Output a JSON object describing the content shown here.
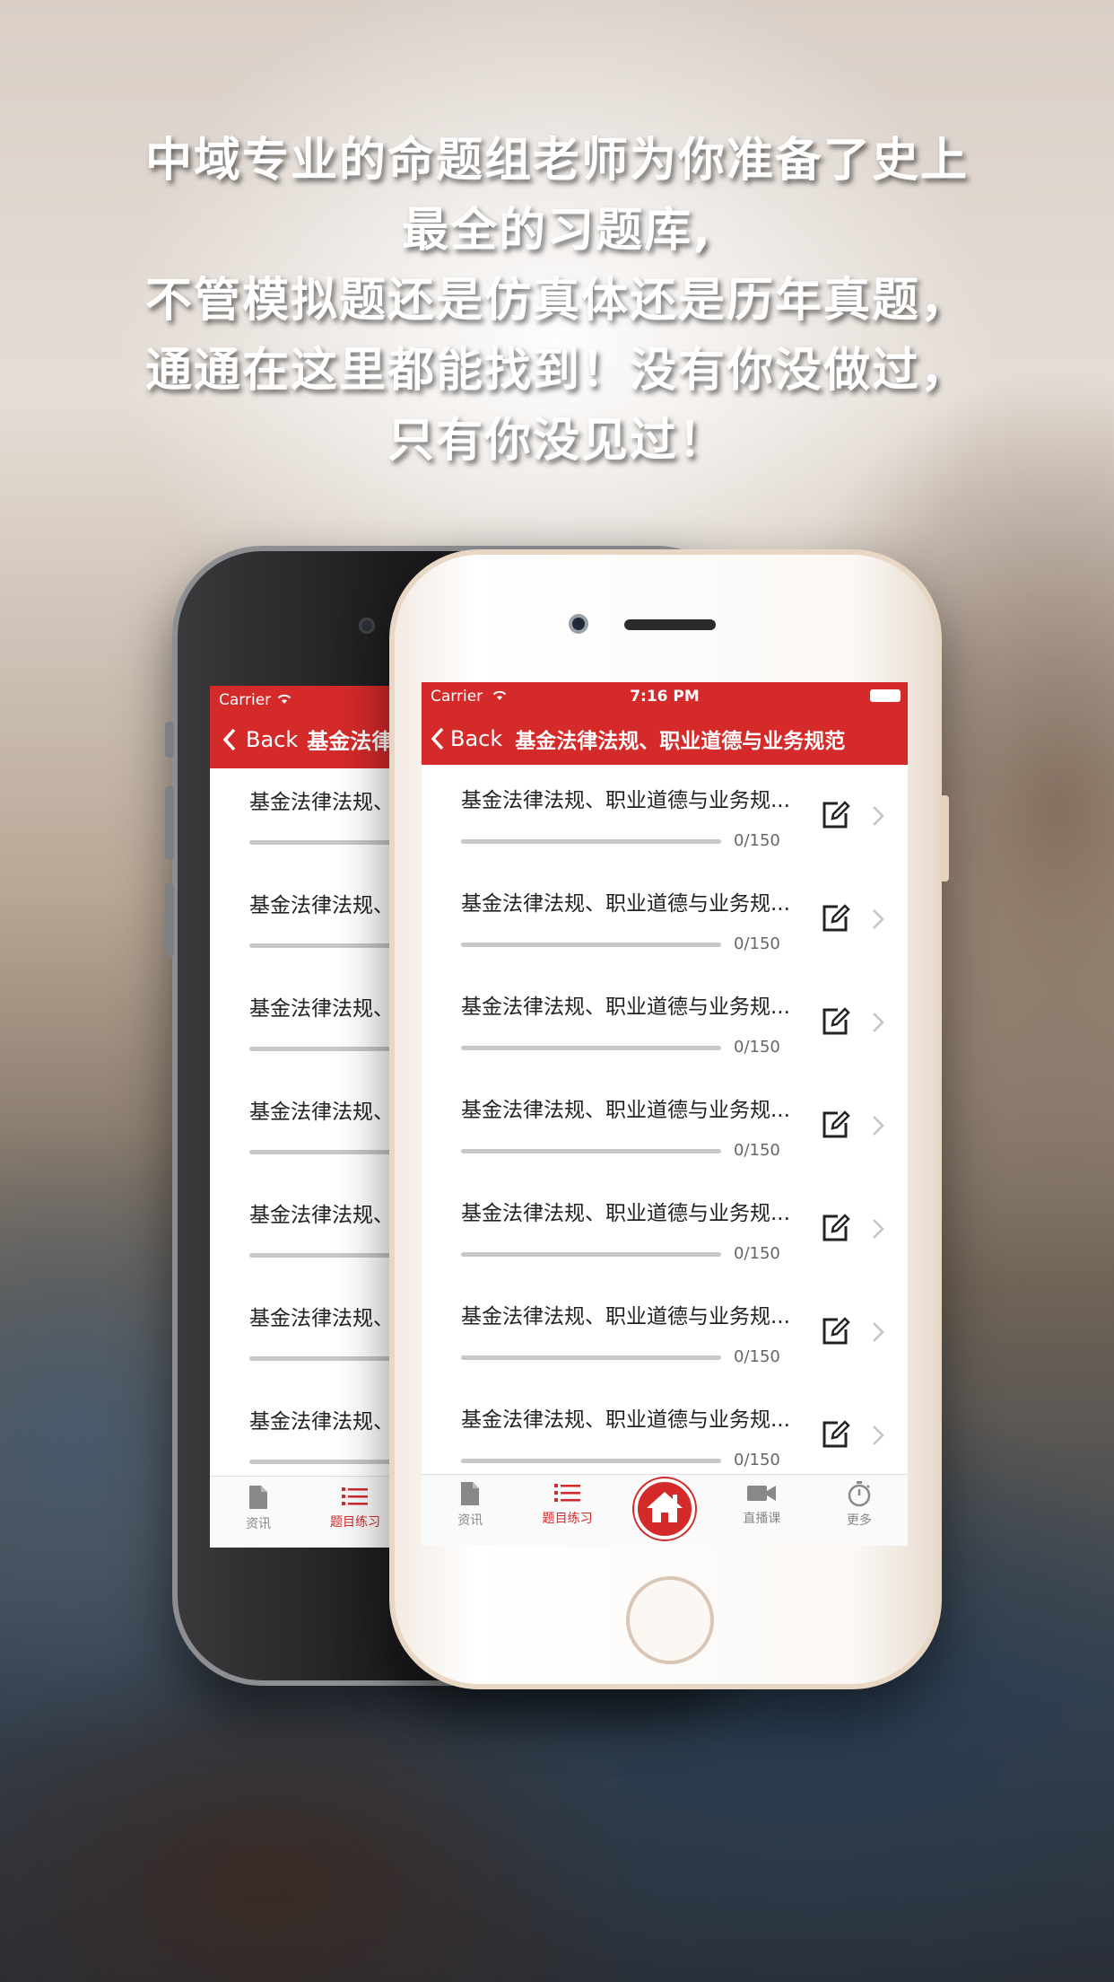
{
  "headline": {
    "line1": "中域专业的命题组老师为你准备了史上",
    "line2": "最全的习题库,",
    "line3": "不管模拟题还是仿真体还是历年真题，",
    "line4": "通通在这里都能找到！没有你没做过，",
    "line5": "只有你没见过！"
  },
  "status_bar": {
    "carrier": "Carrier",
    "time": "7:16 PM"
  },
  "nav": {
    "back_label": "Back",
    "title": "基金法律法规、职业道德与业务规范",
    "back_title_truncated": "基金法律"
  },
  "list": {
    "items": [
      {
        "label": "基金法律法规、职业道德与业务规...",
        "short_label": "基金法律法规、",
        "progress": 0,
        "count": "0/150"
      },
      {
        "label": "基金法律法规、职业道德与业务规...",
        "short_label": "基金法律法规、",
        "progress": 0,
        "count": "0/150"
      },
      {
        "label": "基金法律法规、职业道德与业务规...",
        "short_label": "基金法律法规、",
        "progress": 0,
        "count": "0/150"
      },
      {
        "label": "基金法律法规、职业道德与业务规...",
        "short_label": "基金法律法规、",
        "progress": 0,
        "count": "0/150"
      },
      {
        "label": "基金法律法规、职业道德与业务规...",
        "short_label": "基金法律法规、",
        "progress": 0,
        "count": "0/150"
      },
      {
        "label": "基金法律法规、职业道德与业务规...",
        "short_label": "基金法律法规、",
        "progress": 0,
        "count": "0/150"
      },
      {
        "label": "基金法律法规、职业道德与业务规...",
        "short_label": "基金法律法规、",
        "progress": 0,
        "count": "0/150"
      }
    ]
  },
  "tabs": [
    {
      "label": "资讯",
      "icon": "document-icon",
      "active": false
    },
    {
      "label": "题目练习",
      "icon": "list-icon",
      "active": true
    },
    {
      "label": "",
      "icon": "home-icon",
      "active": false
    },
    {
      "label": "直播课",
      "icon": "video-camera-icon",
      "active": false
    },
    {
      "label": "更多",
      "icon": "stopwatch-icon",
      "active": false
    }
  ],
  "colors": {
    "accent": "#d42a2a",
    "tab_inactive": "#888888",
    "progress_track": "#c8c8c8"
  }
}
